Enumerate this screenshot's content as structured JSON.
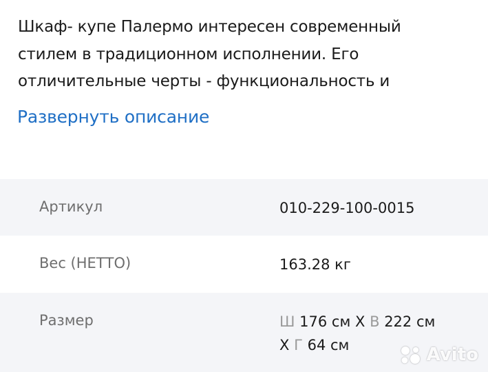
{
  "description": {
    "lines": [
      "Шкаф- купе Палермо интересен современный",
      "стилем в традиционном исполнении.  Его",
      "отличительные черты  - функциональность и"
    ],
    "expand_label": "Развернуть описание"
  },
  "specs": [
    {
      "label": "Артикул",
      "value": "010-229-100-0015"
    },
    {
      "label": "Вес (НЕТТО)",
      "value": "163.28 кг"
    },
    {
      "label": "Размер",
      "w_letter": "Ш",
      "w_value": "176 см",
      "sep1": "X",
      "h_letter": "В",
      "h_value": "222 см",
      "sep2": "X",
      "d_letter": "Г",
      "d_value": "64 см"
    }
  ],
  "watermark": {
    "text": "Avito",
    "icon": "avito-logo-icon"
  },
  "colors": {
    "link": "#1f6fc5",
    "row_shade": "#f4f5f8",
    "label": "#6e6e6e"
  }
}
